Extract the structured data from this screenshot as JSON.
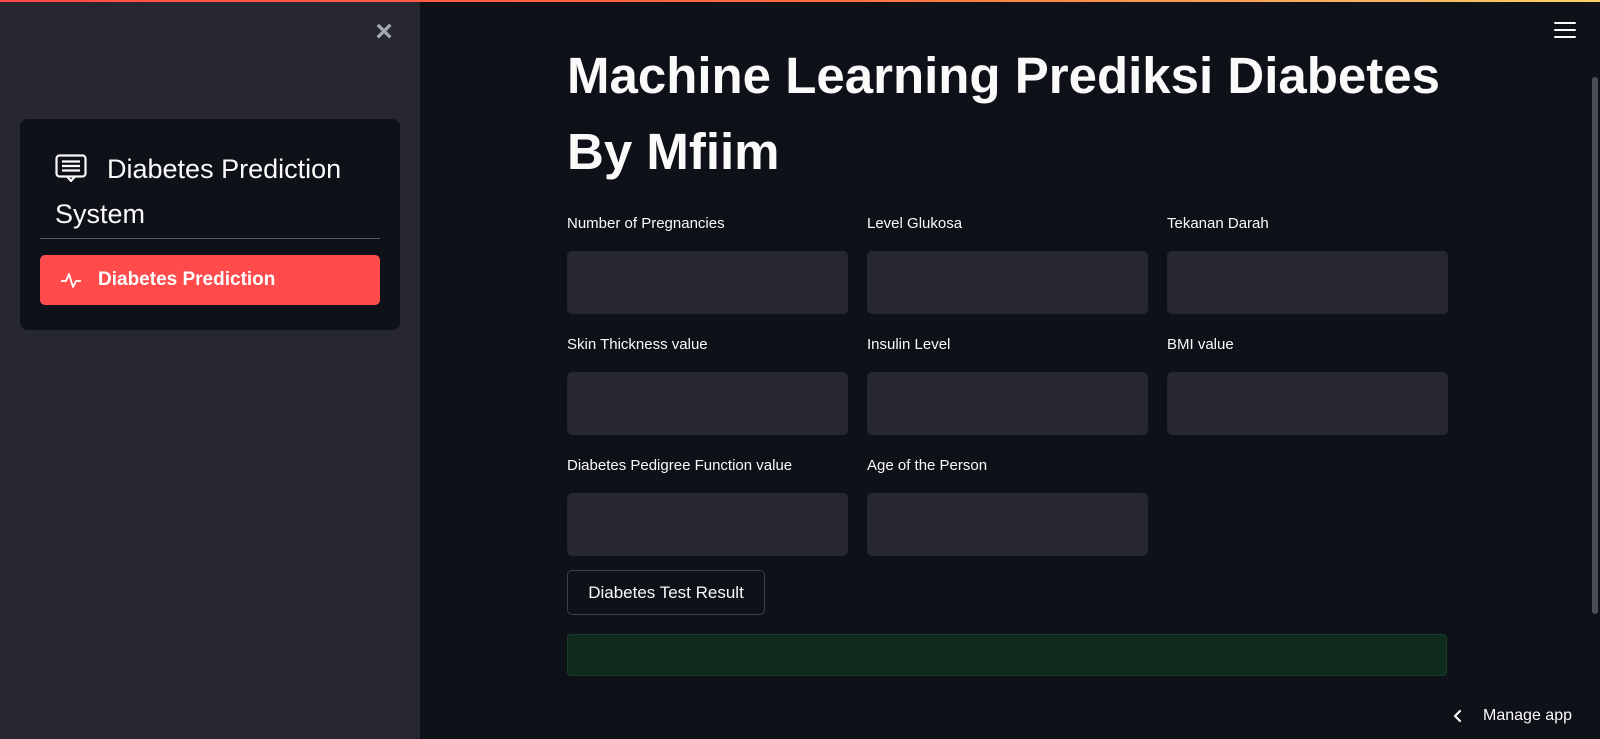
{
  "sidebar": {
    "close_icon": "close-icon",
    "menu": {
      "title": "Diabetes Prediction System",
      "title_icon": "clipboard-list-icon",
      "items": [
        {
          "label": "Diabetes Prediction",
          "icon": "activity-icon",
          "active": true
        }
      ]
    }
  },
  "main": {
    "title": "Machine Learning Prediksi Diabetes By Mfiim",
    "fields": [
      {
        "label": "Number of Pregnancies",
        "value": ""
      },
      {
        "label": "Level Glukosa",
        "value": ""
      },
      {
        "label": "Tekanan Darah",
        "value": ""
      },
      {
        "label": "Skin Thickness value",
        "value": ""
      },
      {
        "label": "Insulin Level",
        "value": ""
      },
      {
        "label": "BMI value",
        "value": ""
      },
      {
        "label": "Diabetes Pedigree Function value",
        "value": ""
      },
      {
        "label": "Age of the Person",
        "value": ""
      }
    ],
    "submit_label": "Diabetes Test Result",
    "result_text": ""
  },
  "footer": {
    "manage_app_label": "Manage app"
  },
  "colors": {
    "background": "#0e1117",
    "sidebar": "#262730",
    "accent": "#ff4b4b",
    "success_bg": "#0f2b1d"
  }
}
